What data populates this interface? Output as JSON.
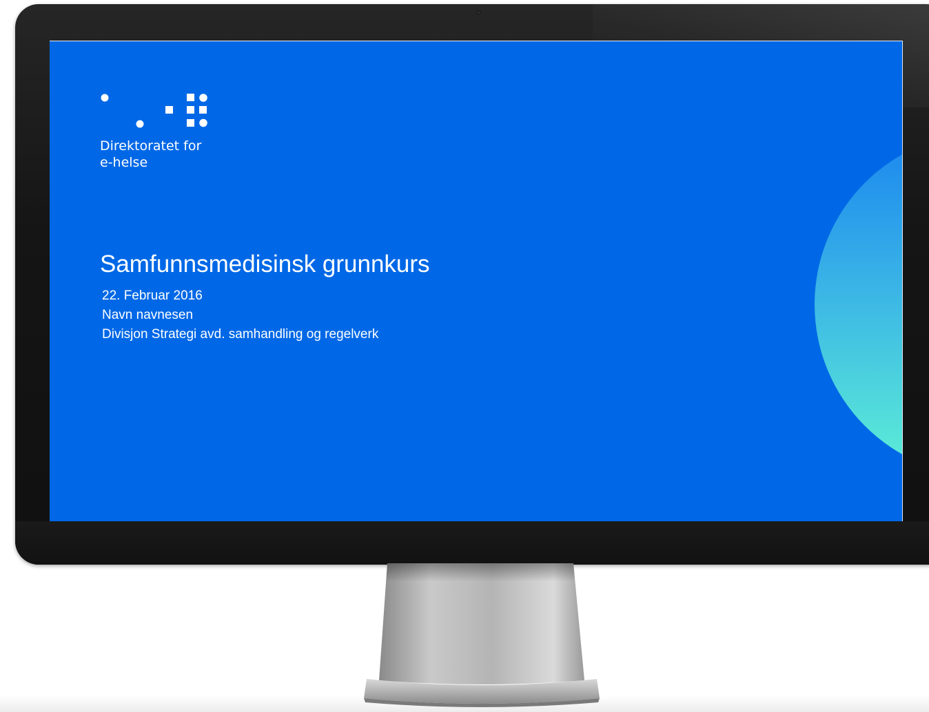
{
  "slide": {
    "logo": {
      "line1": "Direktoratet for",
      "line2": "e-helse"
    },
    "title": "Samfunnsmedisinsk grunnkurs",
    "date": "22. Februar 2016",
    "presenter": "Navn navnesen",
    "department": "Divisjon Strategi avd. samhandling og regelverk"
  },
  "colors": {
    "slide_background": "#0068e6",
    "accent_gradient_top": "#1a86ef",
    "accent_gradient_bottom": "#5ef0d6",
    "text": "#ffffff",
    "bezel": "#151515",
    "stand": "#a8a8a8"
  }
}
